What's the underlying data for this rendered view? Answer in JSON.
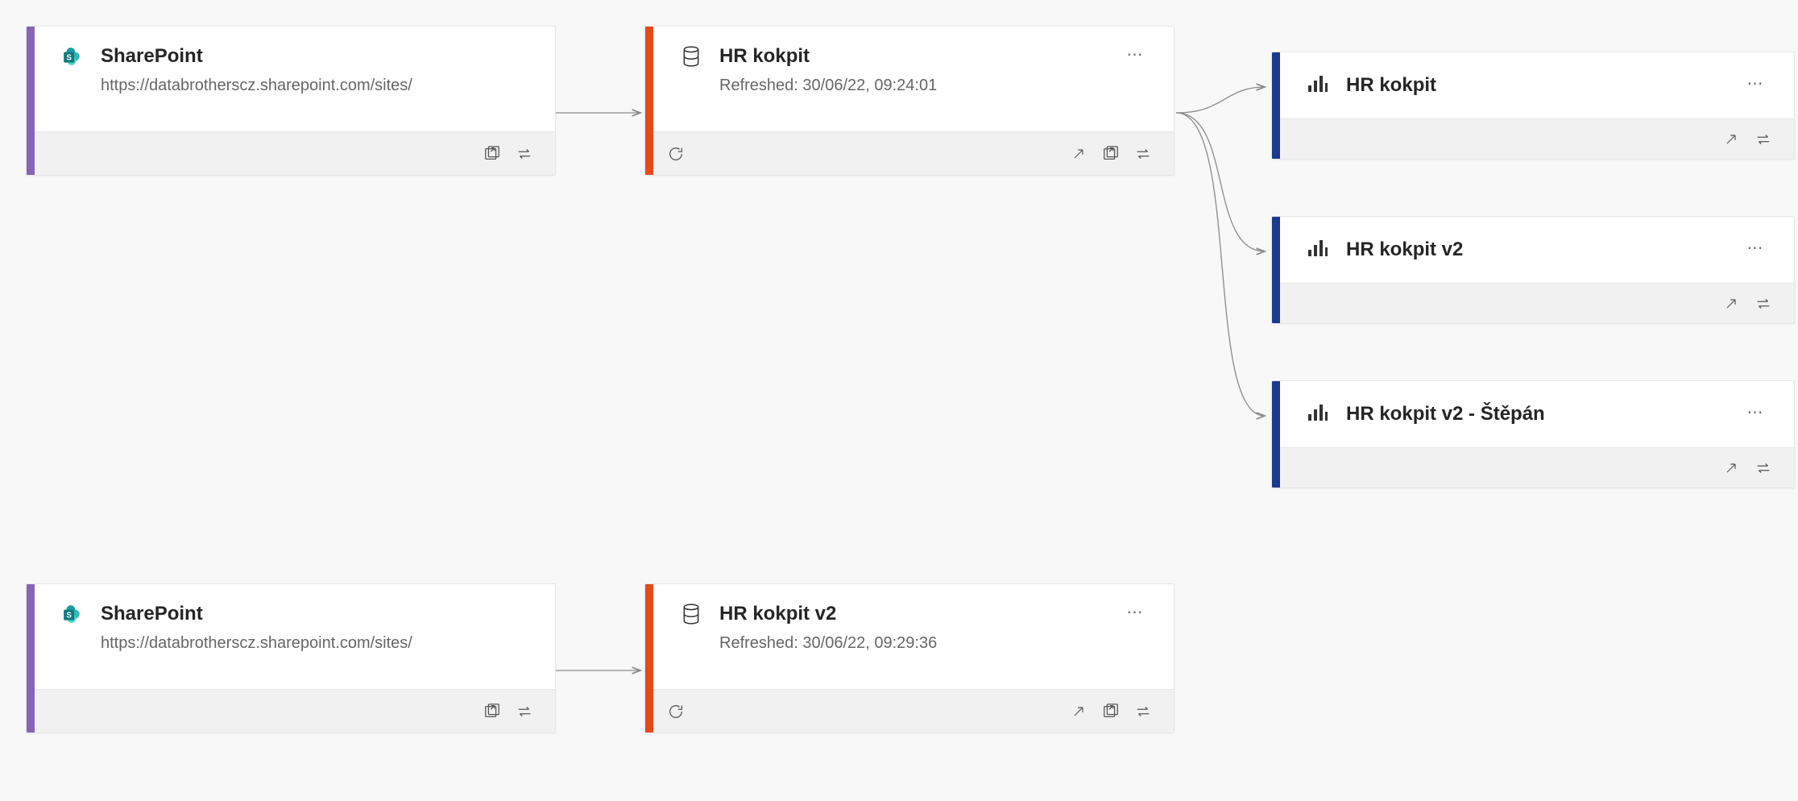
{
  "colors": {
    "source_accent": "#8764b8",
    "dataset_accent": "#e64a19",
    "report_accent": "#1a3a8c",
    "sharepoint_blue": "#0078d4"
  },
  "cards": {
    "src1": {
      "title": "SharePoint",
      "subtitle": "https://databrotherscz.sharepoint.com/sites/"
    },
    "src2": {
      "title": "SharePoint",
      "subtitle": "https://databrotherscz.sharepoint.com/sites/"
    },
    "ds1": {
      "title": "HR kokpit",
      "subtitle": "Refreshed: 30/06/22, 09:24:01"
    },
    "ds2": {
      "title": "HR kokpit v2",
      "subtitle": "Refreshed: 30/06/22, 09:29:36"
    },
    "rpt1": {
      "title": "HR kokpit"
    },
    "rpt2": {
      "title": "HR kokpit v2"
    },
    "rpt3": {
      "title": "HR kokpit v2 - Štěpán"
    }
  }
}
